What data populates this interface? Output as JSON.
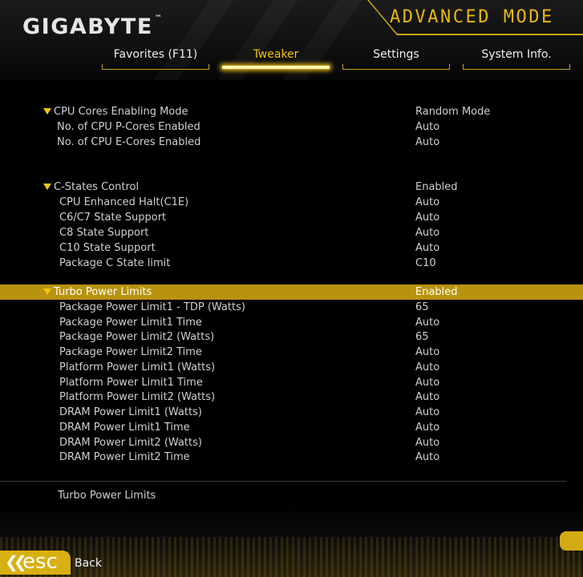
{
  "brand": {
    "logo": "GIGABYTE",
    "mark": "™"
  },
  "mode": {
    "title": "ADVANCED MODE"
  },
  "tabs": [
    {
      "label": "Favorites (F11)",
      "active": false
    },
    {
      "label": "Tweaker",
      "active": true
    },
    {
      "label": "Settings",
      "active": false
    },
    {
      "label": "System Info.",
      "active": false
    }
  ],
  "settings": {
    "cpu_cores": {
      "title": "CPU Cores Enabling Mode",
      "value": "Random Mode",
      "items": [
        {
          "label": "No. of CPU P-Cores Enabled",
          "value": "Auto"
        },
        {
          "label": "No. of CPU E-Cores Enabled",
          "value": "Auto"
        }
      ]
    },
    "cstates": {
      "title": "C-States Control",
      "value": "Enabled",
      "items": [
        {
          "label": "CPU Enhanced Halt(C1E)",
          "value": "Auto"
        },
        {
          "label": "C6/C7 State Support",
          "value": "Auto"
        },
        {
          "label": "C8 State Support",
          "value": "Auto"
        },
        {
          "label": "C10 State Support",
          "value": "Auto"
        },
        {
          "label": "Package C State limit",
          "value": "C10"
        }
      ]
    },
    "turbo": {
      "title": "Turbo Power Limits",
      "value": "Enabled",
      "items": [
        {
          "label": "Package Power Limit1 - TDP (Watts)",
          "value": "65"
        },
        {
          "label": "Package Power Limit1 Time",
          "value": "Auto"
        },
        {
          "label": "Package Power Limit2 (Watts)",
          "value": "65"
        },
        {
          "label": "Package Power Limit2 Time",
          "value": "Auto"
        },
        {
          "label": "Platform Power Limit1 (Watts)",
          "value": "Auto"
        },
        {
          "label": "Platform Power Limit1 Time",
          "value": "Auto"
        },
        {
          "label": "Platform Power Limit2 (Watts)",
          "value": "Auto"
        },
        {
          "label": "DRAM Power Limit1 (Watts)",
          "value": "Auto"
        },
        {
          "label": "DRAM Power Limit1 Time",
          "value": "Auto"
        },
        {
          "label": "DRAM Power Limit2 (Watts)",
          "value": "Auto"
        },
        {
          "label": "DRAM Power Limit2 Time",
          "value": "Auto"
        }
      ]
    }
  },
  "help": {
    "text": "Turbo Power Limits"
  },
  "footer": {
    "esc_label": "esc",
    "back_label": "Back"
  },
  "colors": {
    "accent": "#f5c518",
    "selected_row": "#b8930e",
    "text": "#d0d0d0"
  }
}
